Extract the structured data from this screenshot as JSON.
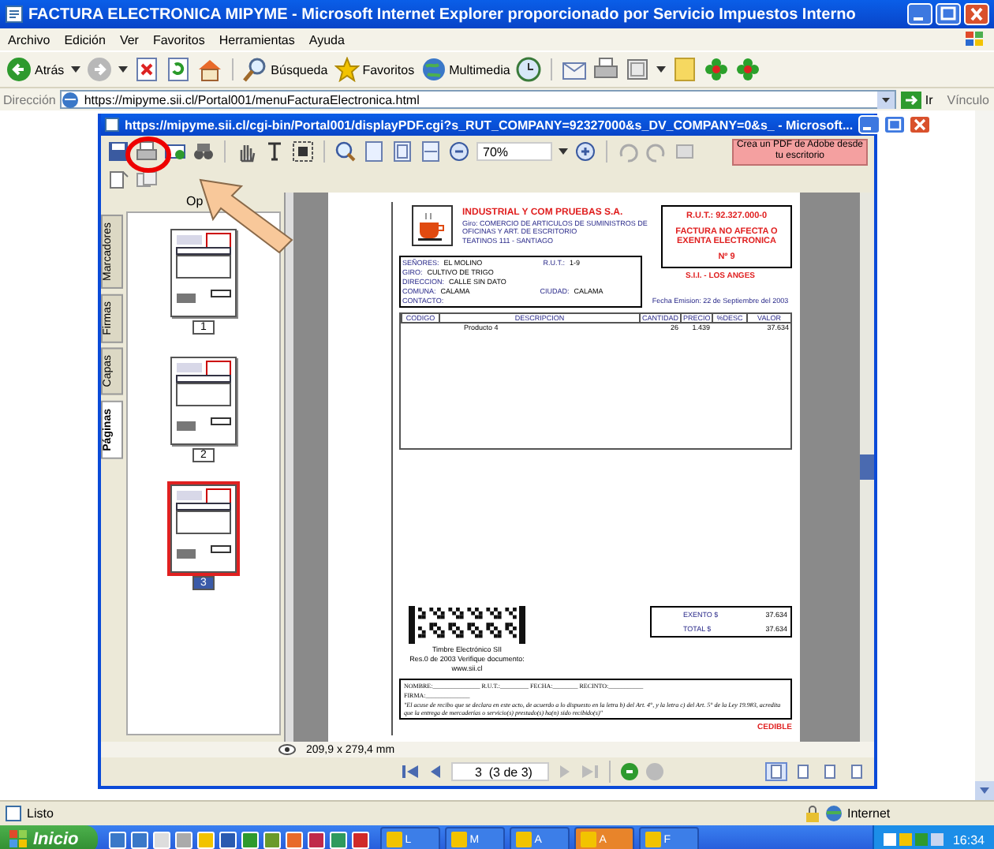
{
  "browser": {
    "title": "FACTURA ELECTRONICA MIPYME - Microsoft Internet Explorer proporcionado por Servicio Impuestos Interno",
    "menu": [
      "Archivo",
      "Edición",
      "Ver",
      "Favoritos",
      "Herramientas",
      "Ayuda"
    ],
    "toolbar": [
      {
        "kind": "back",
        "label": "Atrás"
      },
      {
        "kind": "forward"
      },
      {
        "kind": "stop"
      },
      {
        "kind": "refresh"
      },
      {
        "kind": "home"
      },
      {
        "kind": "search",
        "label": "Búsqueda"
      },
      {
        "kind": "favorites",
        "label": "Favoritos"
      },
      {
        "kind": "media",
        "label": "Multimedia"
      },
      {
        "kind": "history"
      },
      {
        "kind": "mail"
      },
      {
        "kind": "print"
      },
      {
        "kind": "edit"
      },
      {
        "kind": "note"
      },
      {
        "kind": "flower"
      },
      {
        "kind": "flower"
      }
    ],
    "address": {
      "label": "Dirección",
      "value": "https://mipyme.sii.cl/Portal001/menuFacturaElectronica.html",
      "go": "Ir",
      "links": "Vínculo"
    },
    "status": {
      "text": "Listo",
      "zone": "Internet"
    }
  },
  "pdf_window": {
    "title": "https://mipyme.sii.cl/cgi-bin/Portal001/displayPDF.cgi?s_RUT_COMPANY=92327000&s_DV_COMPANY=0&s_ - Microsoft...",
    "zoom": "70%",
    "promo": "Crea un PDF de Adobe desde tu escritorio",
    "side_tabs": [
      {
        "label": "Marcadores",
        "selected": false
      },
      {
        "label": "Firmas",
        "selected": false
      },
      {
        "label": "Capas",
        "selected": false
      },
      {
        "label": "Páginas",
        "selected": true
      }
    ],
    "panel_header": "Op",
    "thumbnails": [
      {
        "label": "1",
        "selected": false
      },
      {
        "label": "2",
        "selected": false
      },
      {
        "label": "3",
        "selected": true
      }
    ],
    "page_size": "209,9 x 279,4 mm",
    "page_field": "3  (3 de 3)"
  },
  "invoice": {
    "company": "INDUSTRIAL Y COM PRUEBAS S.A.",
    "giro": "Giro: COMERCIO DE ARTICULOS DE SUMINISTROS DE OFICINAS Y ART. DE ESCRITORIO",
    "address": "TEATINOS 111 - SANTIAGO",
    "rut": "R.U.T.: 92.327.000-0",
    "doc_type": "FACTURA NO AFECTA O EXENTA ELECTRONICA",
    "number": "Nº 9",
    "office": "S.I.I. - LOS ANGES",
    "date": "Fecha Emision: 22 de Septiembre del 2003",
    "customer": [
      {
        "label": "SEÑORES:",
        "value": "EL MOLINO",
        "label2": "R.U.T.:",
        "value2": "1-9"
      },
      {
        "label": "GIRO:",
        "value": "CULTIVO DE TRIGO"
      },
      {
        "label": "DIRECCION:",
        "value": "CALLE SIN DATO"
      },
      {
        "label": "COMUNA:",
        "value": "CALAMA",
        "label2": "CIUDAD:",
        "value2": "CALAMA"
      },
      {
        "label": "CONTACTO:"
      }
    ],
    "columns": [
      "CODIGO",
      "DESCRIPCION",
      "CANTIDAD",
      "PRECIO",
      "%DESC",
      "VALOR"
    ],
    "rows": [
      [
        "",
        "Producto 4",
        "26",
        "1.439",
        "",
        "37.634"
      ]
    ],
    "totals": [
      {
        "label": "EXENTO $",
        "value": "37.634"
      },
      {
        "label": "TOTAL $",
        "value": "37.634"
      }
    ],
    "stamp_caption": [
      "Timbre Electrónico SII",
      "Res.0 de 2003 Verifique documento:",
      "www.sii.cl"
    ],
    "receipt_fields": "NOMBRE:_______________ R.U.T.:_________ FECHA:________ RECINTO:___________",
    "receipt_sign": "FIRMA:______________",
    "receipt_note": "\"El acuse de recibo que se declara en este acto, de acuerdo a lo dispuesto en la letra b) del Art. 4°, y la letra c) del Art. 5° de la Ley 19.983, acredita que la entrega de mercaderías o servicio(s) prestado(s) ha(n) sido recibido(s)\"",
    "cedible": "CEDIBLE"
  },
  "taskbar": {
    "start": "Inicio",
    "tasks": [
      {
        "label": "L",
        "selected": false
      },
      {
        "label": "M",
        "selected": false
      },
      {
        "label": "A",
        "selected": false
      },
      {
        "label": "A",
        "selected": true
      },
      {
        "label": "F",
        "selected": false
      }
    ],
    "clock": "16:34"
  }
}
